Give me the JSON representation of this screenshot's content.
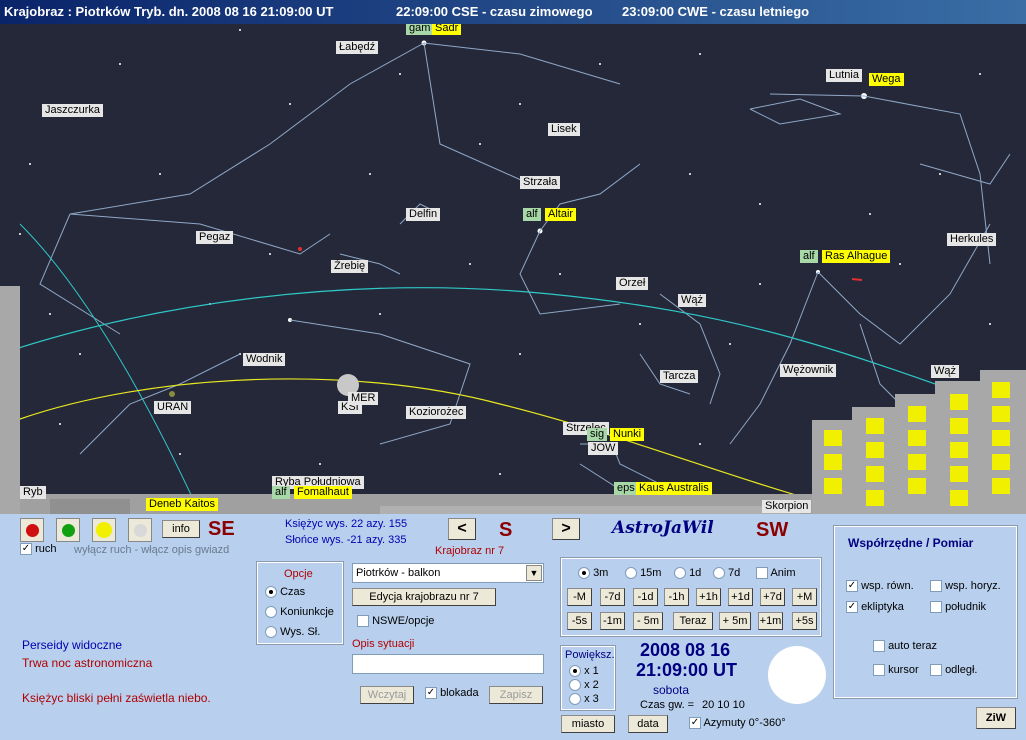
{
  "title": {
    "main": "Krajobraz : Piotrków Tryb. dn. 2008 08 16    21:09:00 UT",
    "cse": "22:09:00 CSE - czasu zimowego",
    "cwe": "23:09:00 CWE - czasu letniego"
  },
  "sky": {
    "constellations": [
      "Łabędź",
      "Lutnia",
      "Jaszczurka",
      "Lisek",
      "Strzała",
      "Delfin",
      "Pegaz",
      "Źrebię",
      "Herkules",
      "Orzeł",
      "Wąż",
      "Wodnik",
      "Tarcza",
      "Wężownik",
      "Wąż",
      "Koziorożec",
      "Strzelec",
      "Ryba Południowa",
      "Skorpion"
    ],
    "stars": {
      "sadr_prefix": "gam",
      "sadr": "Sadr",
      "wega": "Wega",
      "altair_prefix": "alf",
      "altair": "Altair",
      "rasalhague_prefix": "alf",
      "rasalhague": "Ras Alhague",
      "nunki_prefix": "sig",
      "nunki": "Nunki",
      "kaus_prefix": "eps",
      "kaus": "Kaus Australis",
      "fomalhaut_prefix": "alf",
      "fomalhaut": "Fomalhaut",
      "kaitos": "Deneb Kaitos"
    },
    "planets": {
      "uran": "URAN",
      "ksi": "KSI",
      "mer": "MER",
      "jow": "JOW"
    },
    "edge_label": "Ryb"
  },
  "controls": {
    "info": "info",
    "dir_left": "SE",
    "dir_center": "S",
    "dir_right": "SW",
    "nav_prev": "<",
    "nav_next": ">",
    "ruch_label": "ruch",
    "ruch_hint": "wyłącz ruch - włącz opis gwiazd",
    "moon_info": "Księżyc wys. 22   azy. 155",
    "sun_info": "Słońce wys. -21   azy. 335",
    "krajobraz_nr": "Krajobraz nr 7",
    "app_name": "AstroJaWil"
  },
  "opcje": {
    "title": "Opcje",
    "items": [
      "Czas",
      "Koniunkcje",
      "Wys. Sł."
    ],
    "selected": 0
  },
  "landscape": {
    "select_value": "Piotrków - balkon",
    "edit_button": "Edycja krajobrazu nr 7",
    "nswe_label": "NSWE/opcje",
    "opis_label": "Opis sytuacji",
    "opis_value": "",
    "load_button": "Wczytaj",
    "lock_label": "blokada",
    "save_button": "Zapisz"
  },
  "time_step": {
    "options": [
      "3m",
      "15m",
      "1d",
      "7d"
    ],
    "selected": "3m",
    "anim_label": "Anim",
    "row1": [
      "-M",
      "-7d",
      "-1d",
      "-1h",
      "+1h",
      "+1d",
      "+7d",
      "+M"
    ],
    "row2": [
      "-5s",
      "-1m",
      "- 5m",
      "Teraz",
      "+ 5m",
      "+1m",
      "+5s"
    ]
  },
  "zoom": {
    "title": "Powiększ.",
    "options": [
      "x 1",
      "x 2",
      "x 3"
    ],
    "selected": 0
  },
  "datetime": {
    "date": "2008 08 16",
    "time": "21:09:00 UT",
    "weekday": "sobota",
    "sidereal_label": "Czas gw. =",
    "sidereal_value": "20 10 10",
    "city_button": "miasto",
    "date_button": "data",
    "azimuth_label": "Azymuty 0°-360°"
  },
  "coords": {
    "title": "Współrzędne / Pomiar",
    "wsp_rown": "wsp. równ.",
    "wsp_horyz": "wsp. horyz.",
    "ekliptyka": "ekliptyka",
    "poludnik": "południk",
    "auto_teraz": "auto teraz",
    "kursor": "kursor",
    "odlegl": "odległ.",
    "ziw": "ZiW"
  },
  "messages": {
    "perseidy": "Perseidy widoczne",
    "noc": "Trwa noc astronomiczna",
    "ksiezyc": "Księżyc bliski pełni zaświetla niebo."
  },
  "colors": {
    "sky": "#252838",
    "panel": "#b8d0ee",
    "label_yellow": "#ffff00",
    "label_green": "#a8d8a8",
    "direction": "#8b0000"
  }
}
